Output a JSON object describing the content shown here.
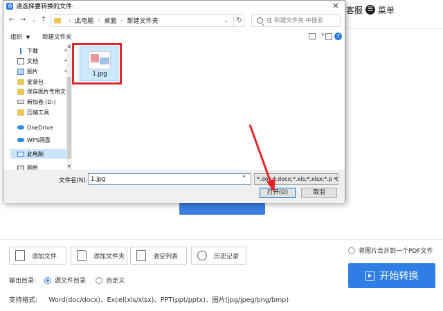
{
  "app": {
    "header": {
      "service_label": "客服",
      "menu_label": "菜单"
    },
    "toolbar": {
      "add_file": "添加文件",
      "add_folder": "添加文件夹",
      "clear_list": "清空列表",
      "history": "历史记录"
    },
    "merge_option": "将图片合并到一个PDF文件",
    "output": {
      "label": "输出目录:",
      "source_dir": "源文件目录",
      "custom": "自定义"
    },
    "formats": {
      "label": "支持格式:",
      "value": "Word(doc/docx)、Excel(xls/xlsx)、PPT(ppt/pptx)、图片(jpg/jpeg/png/bmp)"
    },
    "start_button": "开始转换"
  },
  "dialog": {
    "title": "请选择要转换的文件:",
    "breadcrumb": [
      "此电脑",
      "桌面",
      "新建文件夹"
    ],
    "search_placeholder": "在 新建文件夹 中搜索",
    "organize": "组织",
    "new_folder": "新建文件夹",
    "nav_items": [
      {
        "label": "下载",
        "icon": "download-icon",
        "pinned": true
      },
      {
        "label": "文档",
        "icon": "document-icon",
        "pinned": true
      },
      {
        "label": "图片",
        "icon": "picture-icon",
        "pinned": true
      },
      {
        "label": "安装包",
        "icon": "folder-icon"
      },
      {
        "label": "保存图片专用文件夹",
        "icon": "folder-icon"
      },
      {
        "label": "新加卷 (D:)",
        "icon": "drive-icon"
      },
      {
        "label": "压缩工具",
        "icon": "folder-icon"
      },
      {
        "label": "OneDrive",
        "icon": "onedrive-icon"
      },
      {
        "label": "WPS网盘",
        "icon": "wps-cloud-icon"
      },
      {
        "label": "此电脑",
        "icon": "computer-icon",
        "selected": true
      },
      {
        "label": "网络",
        "icon": "network-icon"
      }
    ],
    "files": [
      {
        "name": "1.jpg"
      }
    ],
    "filename_label": "文件名(N):",
    "filename_value": "1.jpg",
    "filetype_value": "*.doc;*.docx;*.xls;*.xlsx;*.ppt;*",
    "open_button": "打开(O)",
    "cancel_button": "取消"
  },
  "colors": {
    "accent": "#2f7ee6",
    "highlight": "#e3252b",
    "selection": "#cce8ff"
  }
}
